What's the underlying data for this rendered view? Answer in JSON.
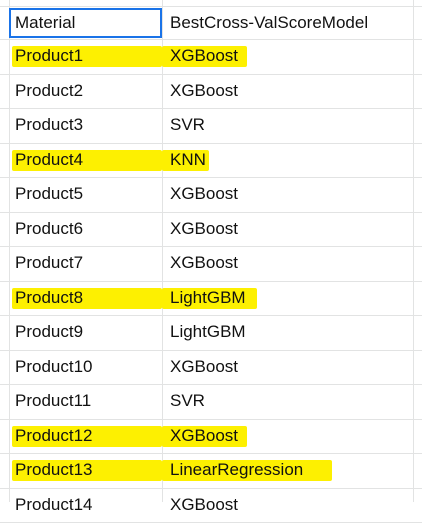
{
  "header": {
    "col_a": "Material",
    "col_b": "BestCross-ValScoreModel"
  },
  "rows": [
    {
      "material": "Product1",
      "model": "XGBoost",
      "highlighted": true
    },
    {
      "material": "Product2",
      "model": "XGBoost",
      "highlighted": false
    },
    {
      "material": "Product3",
      "model": "SVR",
      "highlighted": false
    },
    {
      "material": "Product4",
      "model": "KNN",
      "highlighted": true
    },
    {
      "material": "Product5",
      "model": "XGBoost",
      "highlighted": false
    },
    {
      "material": "Product6",
      "model": "XGBoost",
      "highlighted": false
    },
    {
      "material": "Product7",
      "model": "XGBoost",
      "highlighted": false
    },
    {
      "material": "Product8",
      "model": "LightGBM",
      "highlighted": true
    },
    {
      "material": "Product9",
      "model": "LightGBM",
      "highlighted": false
    },
    {
      "material": "Product10",
      "model": "XGBoost",
      "highlighted": false
    },
    {
      "material": "Product11",
      "model": "SVR",
      "highlighted": false
    },
    {
      "material": "Product12",
      "model": "XGBoost",
      "highlighted": true
    },
    {
      "material": "Product13",
      "model": "LinearRegression",
      "highlighted": true
    },
    {
      "material": "Product14",
      "model": "XGBoost",
      "highlighted": false
    }
  ],
  "colors": {
    "highlight": "#fdf001",
    "grid": "#e2e3e3",
    "selection": "#1a73e8"
  }
}
